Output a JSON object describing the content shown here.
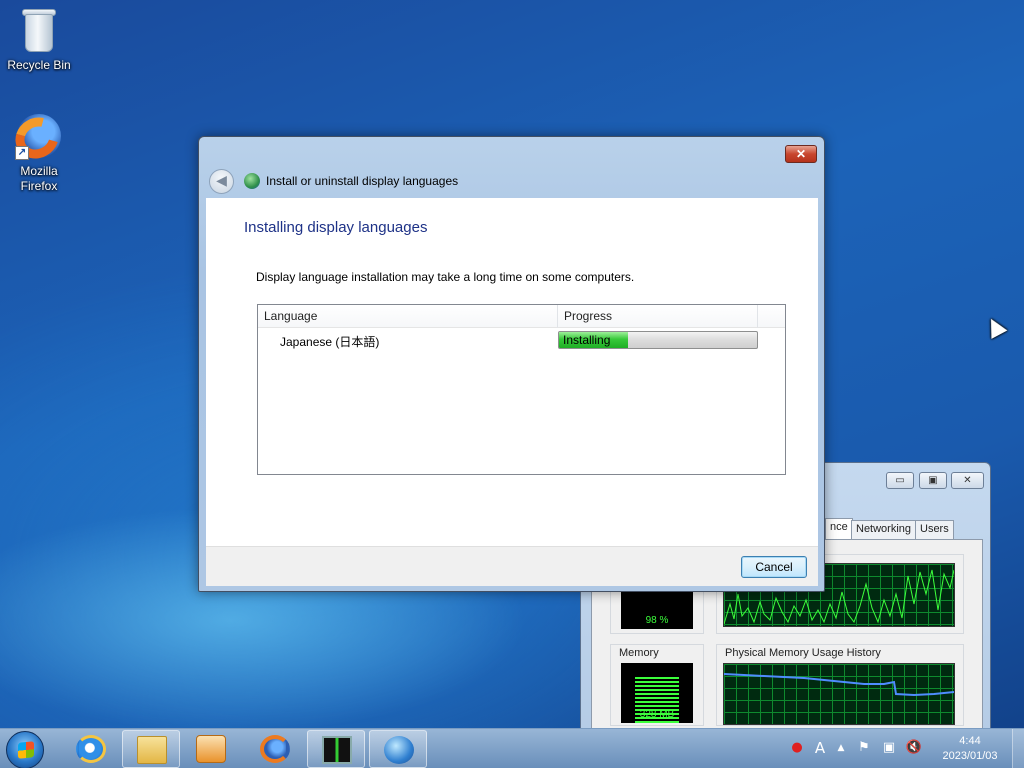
{
  "desktop": {
    "icons": [
      {
        "label": "Recycle Bin"
      },
      {
        "label": "Mozilla Firefox",
        "label_line1": "Mozilla",
        "label_line2": "Firefox"
      }
    ]
  },
  "dialog": {
    "title": "Install or uninstall display languages",
    "close_glyph": "✕",
    "back_glyph": "◀",
    "heading": "Installing display languages",
    "description": "Display language installation may take a long time on some computers.",
    "columns": [
      "Language",
      "Progress"
    ],
    "rows": [
      {
        "language": "Japanese (日本語)",
        "status": "Installing",
        "progress": 0.35
      }
    ],
    "cancel_label": "Cancel"
  },
  "task_manager": {
    "tabs": [
      "nce",
      "Networking",
      "Users"
    ],
    "minimize_glyph": "▭",
    "maximize_glyph": "▣",
    "close_glyph": "✕",
    "cpu_value": "98 %",
    "memory_label": "Memory",
    "memory_value": "328 MB",
    "memory_history_label": "Physical Memory Usage History"
  },
  "taskbar": {
    "pinned": [
      "internet-explorer",
      "windows-explorer",
      "windows-media-player",
      "firefox",
      "task-manager",
      "display-languages"
    ],
    "tray": {
      "lang_indicator": "A",
      "clock_time": "4:44",
      "clock_date": "2023/01/03"
    }
  },
  "colors": {
    "accent_heading": "#1e3287",
    "progress_fill": "#37c93a",
    "close_red": "#c8462e"
  }
}
